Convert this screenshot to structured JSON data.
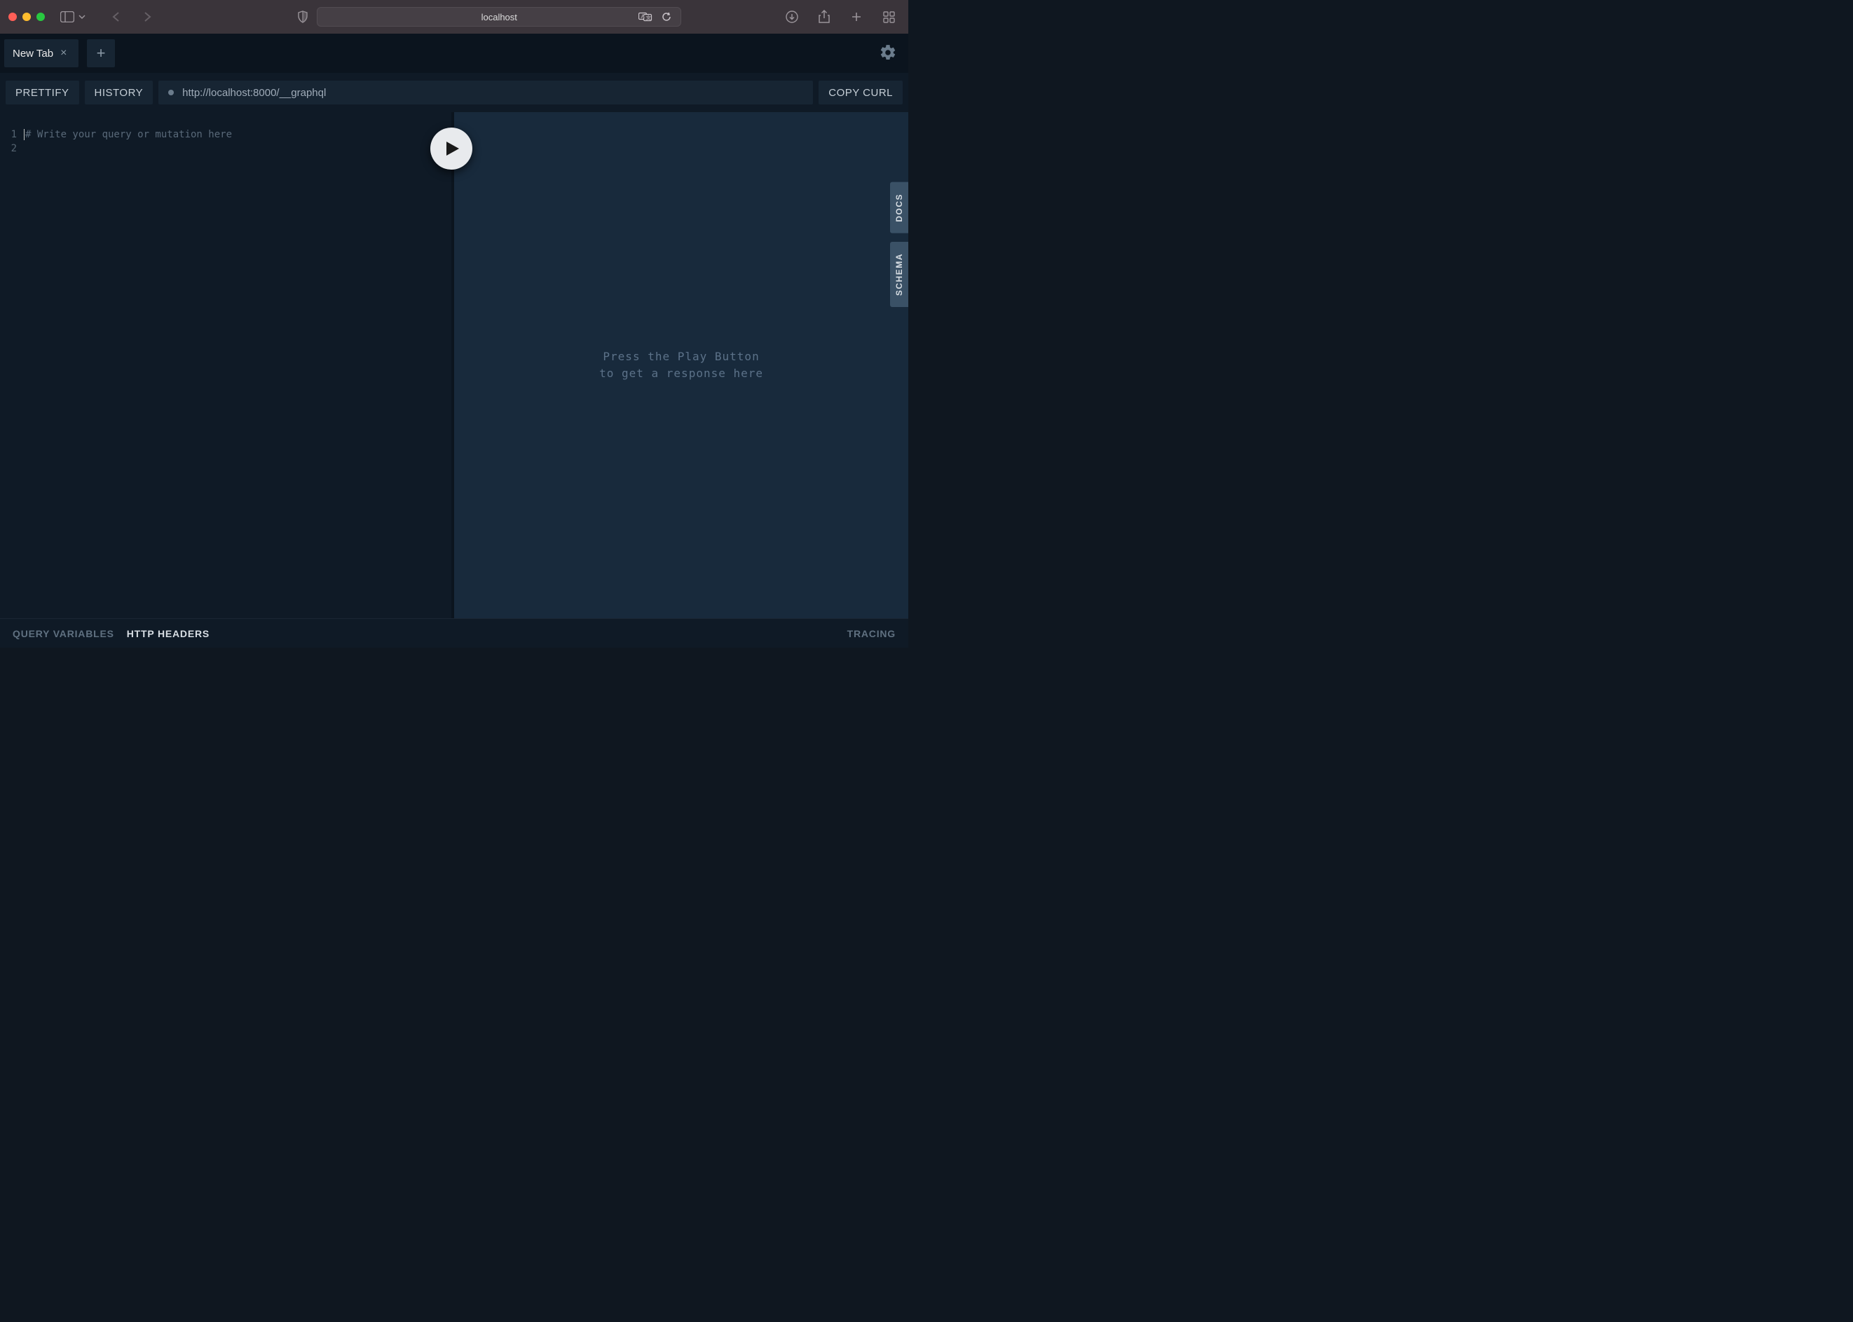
{
  "browser": {
    "url_display": "localhost"
  },
  "tabs": {
    "active_label": "New Tab"
  },
  "toolbar": {
    "prettify": "PRETTIFY",
    "history": "HISTORY",
    "copy_curl": "COPY CURL",
    "endpoint": "http://localhost:8000/__graphql"
  },
  "editor": {
    "lines": [
      "1",
      "2"
    ],
    "placeholder": "# Write your query or mutation here"
  },
  "response": {
    "line1": "Press the Play Button",
    "line2": "to get a response here"
  },
  "side": {
    "docs": "DOCS",
    "schema": "SCHEMA"
  },
  "bottom": {
    "query_variables": "QUERY VARIABLES",
    "http_headers": "HTTP HEADERS",
    "tracing": "TRACING"
  }
}
